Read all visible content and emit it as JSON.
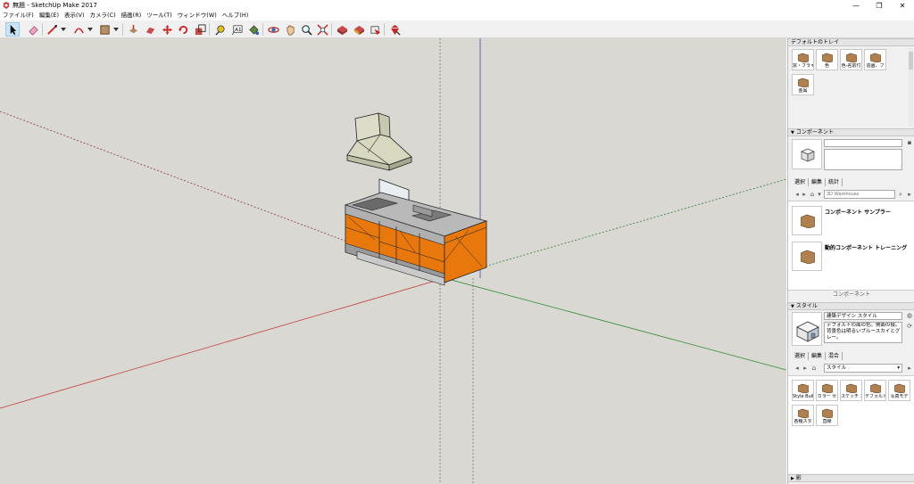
{
  "window": {
    "title": "無題 - SketchUp Make 2017",
    "minimize": "—",
    "maximize": "❐",
    "close": "✕"
  },
  "menu": [
    "ファイル(F)",
    "編集(E)",
    "表示(V)",
    "カメラ(C)",
    "描画(R)",
    "ツール(T)",
    "ウィンドウ(W)",
    "ヘルプ(H)"
  ],
  "toolbar": {
    "tools": [
      "select-tool-icon",
      "eraser-tool-icon",
      "line-tool-icon",
      "arc-tool-icon",
      "rectangle-tool-icon",
      "push-pull-tool-icon",
      "follow-me-tool-icon",
      "move-tool-icon",
      "rotate-tool-icon",
      "scale-tool-icon",
      "tape-measure-tool-icon",
      "text-tool-icon",
      "paint-bucket-tool-icon",
      "orbit-tool-icon",
      "pan-tool-icon",
      "zoom-tool-icon",
      "zoom-extents-tool-icon",
      "warehouse-icon",
      "extension-warehouse-icon",
      "share-model-icon",
      "ruby-console-icon"
    ]
  },
  "colors": {
    "viewport_bg": "#d9d8d2",
    "orange": "#e8780c",
    "axis_red": "#c23b3b",
    "axis_green": "#2e8b2e",
    "axis_blue": "#4a4ab0",
    "panel_bg": "#f0f0f0",
    "accent": "#cce4f7"
  },
  "tray": {
    "title": "デフォルトのトレイ",
    "materials": [
      "窓・ブライ",
      "色",
      "色-名前付",
      "造園、フ",
      "金属"
    ]
  },
  "components": {
    "header": "コンポーネント",
    "tabs": [
      "選択",
      "編集",
      "統計"
    ],
    "search_placeholder": "3D Warehouse",
    "items": [
      {
        "label": "コンポーネント サンプラー"
      },
      {
        "label": "動的コンポーネント トレーニング"
      }
    ],
    "footer": "コンポーネント"
  },
  "styles": {
    "header": "スタイル",
    "style_name": "建築デザイン スタイル",
    "style_desc": "デフォルトの面の色。側面の稜。背景色は明るいブルースカイとグレー。",
    "tabs": [
      "選択",
      "編集",
      "混合"
    ],
    "dropdown_value": "スタイル",
    "collections": [
      "Style Buil",
      "カラー セ",
      "スケッチ エ",
      "デフォルト",
      "写真モデ",
      "各種スタ",
      "直線"
    ]
  },
  "shadows": {
    "header": "影"
  }
}
